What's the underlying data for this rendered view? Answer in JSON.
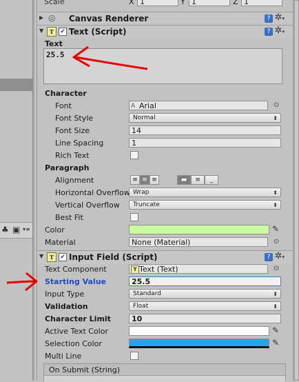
{
  "transform": {
    "label": "Scale",
    "x_label": "X",
    "x": "1",
    "y_label": "Y",
    "y": "1",
    "z_label": "Z",
    "z": "1"
  },
  "canvas_renderer": {
    "title": "Canvas Renderer"
  },
  "text_script": {
    "title": "Text (Script)",
    "text_label": "Text",
    "text_value": "25.5",
    "character_header": "Character",
    "font_label": "Font",
    "font_value": "Arial",
    "font_style_label": "Font Style",
    "font_style_value": "Normal",
    "font_size_label": "Font Size",
    "font_size_value": "14",
    "line_spacing_label": "Line Spacing",
    "line_spacing_value": "1",
    "rich_text_label": "Rich Text",
    "paragraph_header": "Paragraph",
    "alignment_label": "Alignment",
    "h_overflow_label": "Horizontal Overflow",
    "h_overflow_value": "Wrap",
    "v_overflow_label": "Vertical Overflow",
    "v_overflow_value": "Truncate",
    "best_fit_label": "Best Fit",
    "color_label": "Color",
    "color_value": "#c9fba0",
    "material_label": "Material",
    "material_value": "None (Material)"
  },
  "input_field": {
    "title": "Input Field (Script)",
    "text_component_label": "Text Component",
    "text_component_value": "Text (Text)",
    "starting_value_label": "Starting Value",
    "starting_value_value": "25.5",
    "input_type_label": "Input Type",
    "input_type_value": "Standard",
    "validation_label": "Validation",
    "validation_value": "Float",
    "char_limit_label": "Character Limit",
    "char_limit_value": "10",
    "active_text_color_label": "Active Text Color",
    "active_text_color_value": "#ffffff",
    "selection_color_label": "Selection Color",
    "selection_color_value": "#22a8e8",
    "multi_line_label": "Multi Line",
    "on_submit_label": "On Submit (String)"
  },
  "icons": {
    "help": "help-icon",
    "gear": "gear-icon",
    "picker": "eyedropper-icon",
    "object": "object-picker-icon"
  },
  "annotation_color": "#e60000"
}
